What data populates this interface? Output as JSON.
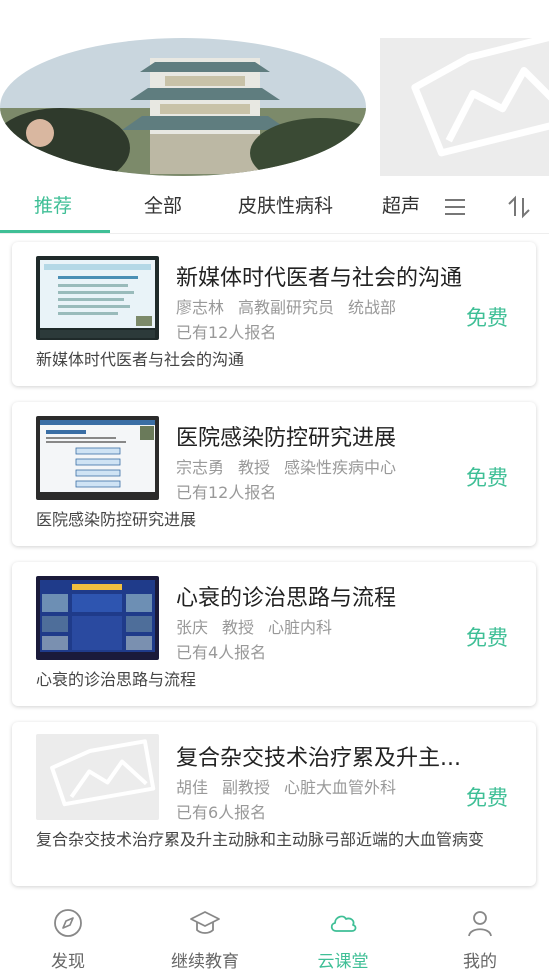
{
  "colors": {
    "accent": "#3fbf96",
    "text_primary": "#222222",
    "text_secondary": "#999999"
  },
  "banner": {
    "slides": [
      {
        "type": "image",
        "description_icon": "building-photo"
      },
      {
        "type": "placeholder",
        "description_icon": "image-placeholder-icon"
      }
    ]
  },
  "tabs": {
    "items": [
      {
        "label": "推荐",
        "active": true
      },
      {
        "label": "全部",
        "active": false
      },
      {
        "label": "皮肤性病科",
        "active": false
      },
      {
        "label": "超声",
        "active": false
      }
    ],
    "menu_icon": "menu-icon",
    "sort_icon": "sort-icon"
  },
  "courses": [
    {
      "title": "新媒体时代医者与社会的沟通",
      "lecturer": "廖志林",
      "rank": "高教副研究员",
      "dept": "统战部",
      "enrolled": "已有12人报名",
      "price": "免费",
      "desc": "新媒体时代医者与社会的沟通"
    },
    {
      "title": "医院感染防控研究进展",
      "lecturer": "宗志勇",
      "rank": "教授",
      "dept": "感染性疾病中心",
      "enrolled": "已有12人报名",
      "price": "免费",
      "desc": "医院感染防控研究进展"
    },
    {
      "title": "心衰的诊治思路与流程",
      "lecturer": "张庆",
      "rank": "教授",
      "dept": "心脏内科",
      "enrolled": "已有4人报名",
      "price": "免费",
      "desc": "心衰的诊治思路与流程"
    },
    {
      "title": "复合杂交技术治疗累及升主动脉和主动脉弓部近端的大血管病变",
      "title_display": "复合杂交技术治疗累及升主...",
      "lecturer": "胡佳",
      "rank": "副教授",
      "dept": "心脏大血管外科",
      "enrolled": "已有6人报名",
      "price": "免费",
      "desc": "复合杂交技术治疗累及升主动脉和主动脉弓部近端的大血管病变"
    }
  ],
  "bottom_nav": {
    "items": [
      {
        "label": "发现",
        "icon": "compass-icon",
        "active": false
      },
      {
        "label": "继续教育",
        "icon": "graduation-cap-icon",
        "active": false
      },
      {
        "label": "云课堂",
        "icon": "cloud-icon",
        "active": true
      },
      {
        "label": "我的",
        "icon": "user-icon",
        "active": false
      }
    ]
  }
}
